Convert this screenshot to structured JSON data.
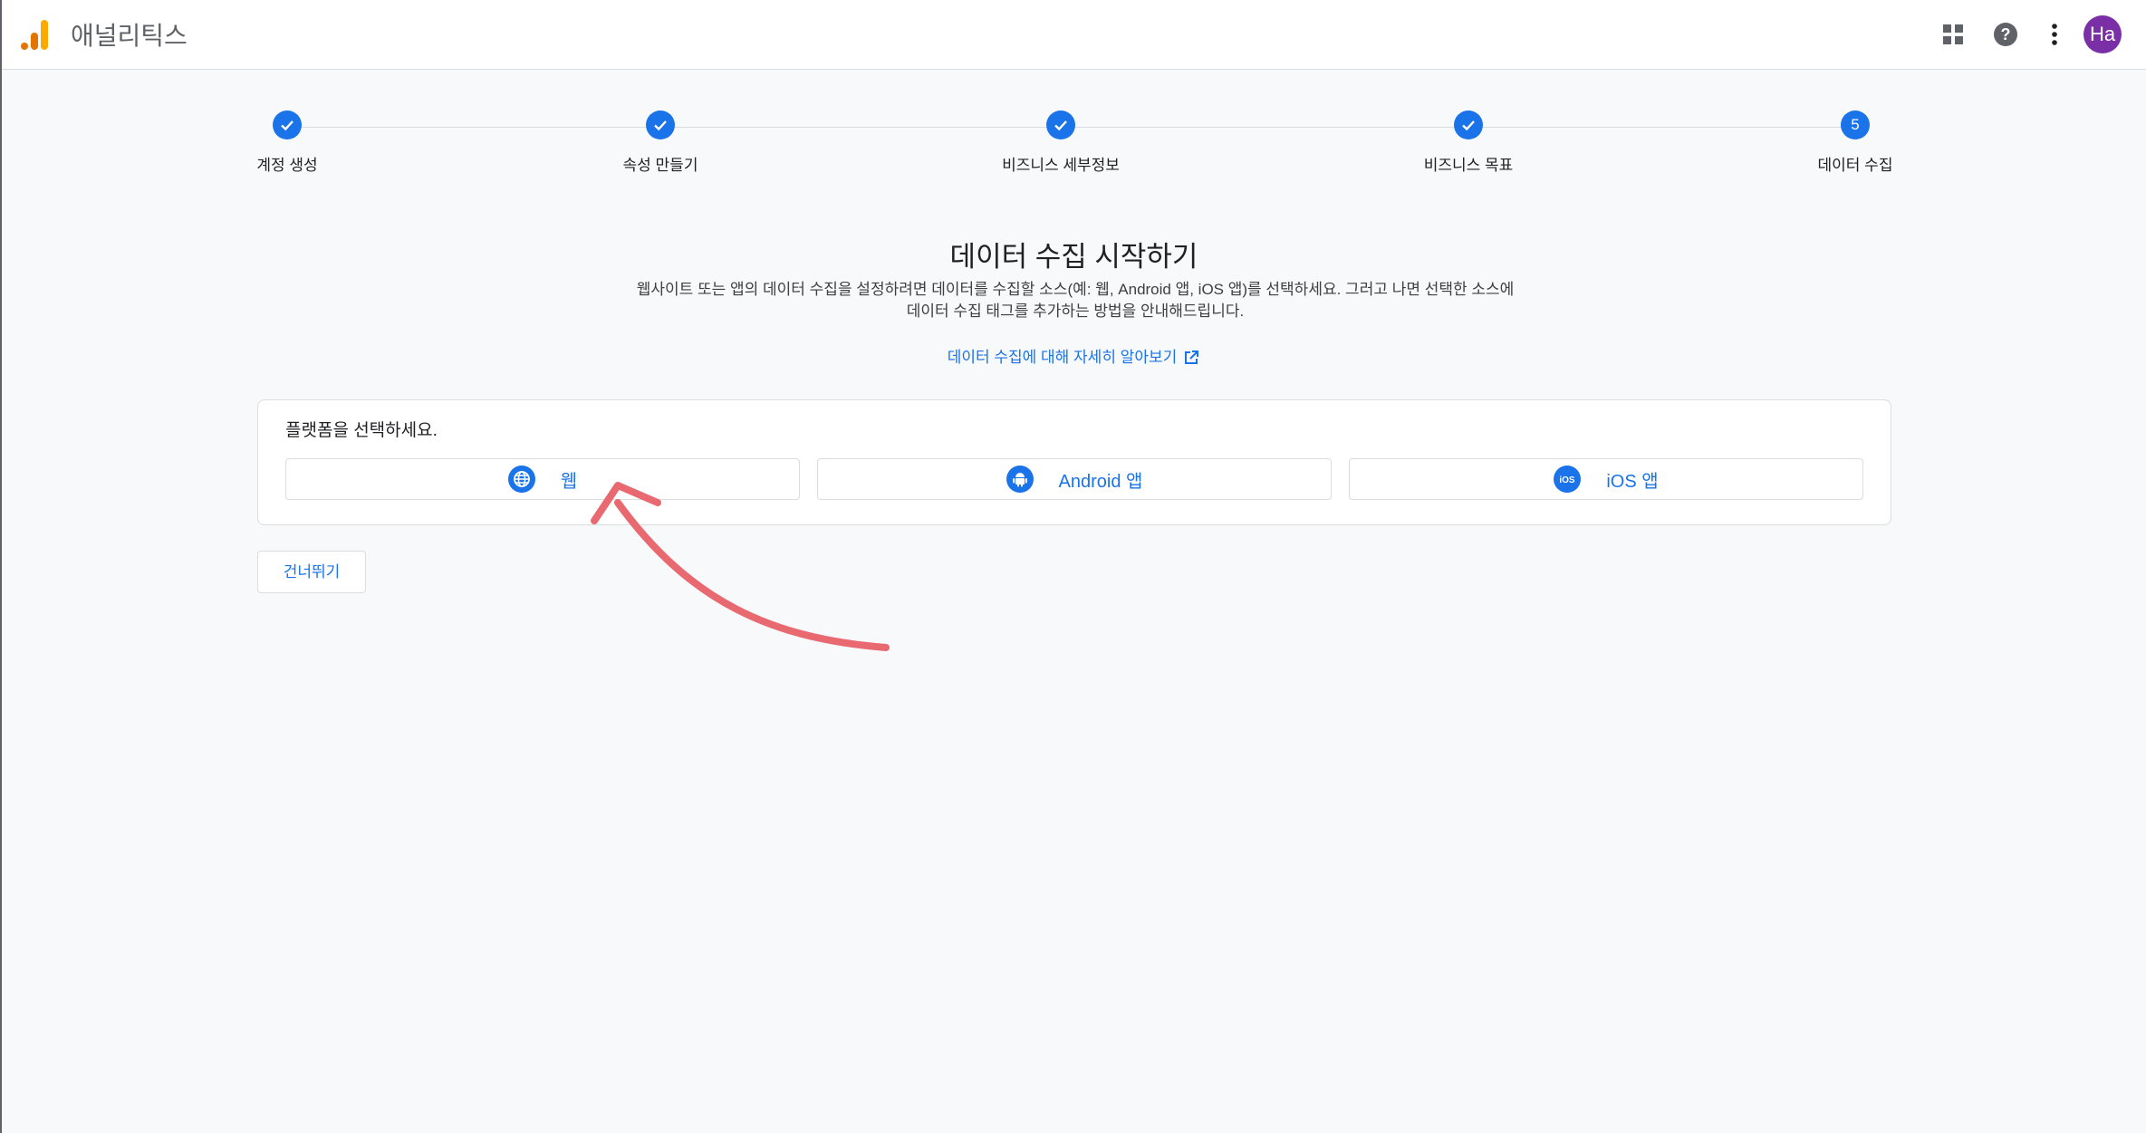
{
  "header": {
    "app_title": "애널리틱스",
    "avatar_initials": "Ha",
    "icons": [
      "analytics-logo-icon",
      "apps-grid-icon",
      "help-icon",
      "more-vert-icon"
    ]
  },
  "stepper": {
    "steps": [
      {
        "label": "계정 생성",
        "state": "complete"
      },
      {
        "label": "속성 만들기",
        "state": "complete"
      },
      {
        "label": "비즈니스 세부정보",
        "state": "complete"
      },
      {
        "label": "비즈니스 목표",
        "state": "complete"
      },
      {
        "label": "데이터 수집",
        "state": "current",
        "number": "5"
      }
    ]
  },
  "main": {
    "title": "데이터 수집 시작하기",
    "description": "웹사이트 또는 앱의 데이터 수집을 설정하려면 데이터를 수집할 소스(예: 웹, Android 앱, iOS 앱)를 선택하세요. 그러고 나면 선택한 소스에 데이터 수집 태그를 추가하는 방법을 안내해드립니다.",
    "learn_more": "데이터 수집에 대해 자세히 알아보기"
  },
  "platform_card": {
    "title": "플랫폼을 선택하세요.",
    "options": [
      {
        "label": "웹",
        "icon": "globe-icon"
      },
      {
        "label": "Android 앱",
        "icon": "android-icon"
      },
      {
        "label": "iOS 앱",
        "icon": "ios-icon"
      }
    ]
  },
  "skip_label": "건너뛰기",
  "colors": {
    "accent": "#1a73e8",
    "avatar": "#7b2fa6",
    "annotation_arrow": "#e8696f"
  }
}
